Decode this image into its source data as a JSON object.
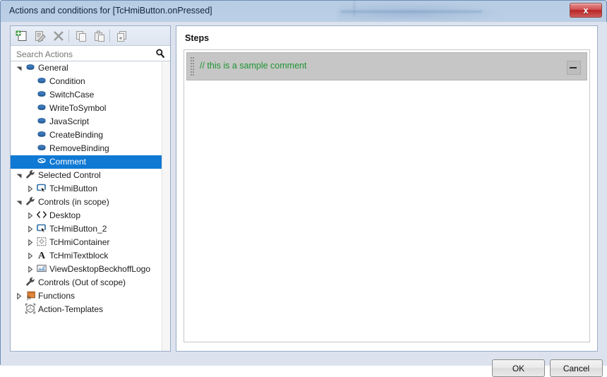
{
  "window": {
    "title": "Actions and conditions for [TcHmiButton.onPressed]",
    "close_label": "x",
    "accent_selected": "#0f79d4",
    "comment_color": "#1f9431",
    "titlebar_color": "#c9dcee",
    "dialog_background": "#dce3ef"
  },
  "toolbar": {
    "items": [
      {
        "name": "new-action-icon",
        "title": "New"
      },
      {
        "name": "edit-action-icon",
        "title": "Edit"
      },
      {
        "name": "delete-action-icon",
        "title": "Delete"
      },
      {
        "name": "copy-action-icon",
        "title": "Copy"
      },
      {
        "name": "paste-action-icon",
        "title": "Paste"
      },
      {
        "name": "duplicate-action-icon",
        "title": "Duplicate"
      }
    ]
  },
  "search": {
    "placeholder": "Search Actions",
    "value": "",
    "icon": "search-icon"
  },
  "tree": {
    "items": [
      {
        "label": "General",
        "depth": 0,
        "icon": "action-node-icon",
        "expander": "expanded",
        "selected": false
      },
      {
        "label": "Condition",
        "depth": 1,
        "icon": "action-node-icon",
        "expander": "none",
        "selected": false
      },
      {
        "label": "SwitchCase",
        "depth": 1,
        "icon": "action-node-icon",
        "expander": "none",
        "selected": false
      },
      {
        "label": "WriteToSymbol",
        "depth": 1,
        "icon": "action-node-icon",
        "expander": "none",
        "selected": false
      },
      {
        "label": "JavaScript",
        "depth": 1,
        "icon": "action-node-icon",
        "expander": "none",
        "selected": false
      },
      {
        "label": "CreateBinding",
        "depth": 1,
        "icon": "action-node-icon",
        "expander": "none",
        "selected": false
      },
      {
        "label": "RemoveBinding",
        "depth": 1,
        "icon": "action-node-icon",
        "expander": "none",
        "selected": false
      },
      {
        "label": "Comment",
        "depth": 1,
        "icon": "comment-node-icon",
        "expander": "none",
        "selected": true
      },
      {
        "label": "Selected Control",
        "depth": 0,
        "icon": "wrench-icon",
        "expander": "expanded",
        "selected": false
      },
      {
        "label": "TcHmiButton",
        "depth": 1,
        "icon": "control-button-icon",
        "expander": "collapsed",
        "selected": false
      },
      {
        "label": "Controls (in scope)",
        "depth": 0,
        "icon": "wrench-icon",
        "expander": "expanded",
        "selected": false
      },
      {
        "label": "Desktop",
        "depth": 1,
        "icon": "code-brackets-icon",
        "expander": "collapsed",
        "selected": false
      },
      {
        "label": "TcHmiButton_2",
        "depth": 1,
        "icon": "control-button-icon",
        "expander": "collapsed",
        "selected": false
      },
      {
        "label": "TcHmiContainer",
        "depth": 1,
        "icon": "container-icon",
        "expander": "collapsed",
        "selected": false
      },
      {
        "label": "TcHmiTextblock",
        "depth": 1,
        "icon": "textblock-icon",
        "expander": "collapsed",
        "selected": false
      },
      {
        "label": "ViewDesktopBeckhoffLogo",
        "depth": 1,
        "icon": "image-icon",
        "expander": "collapsed",
        "selected": false
      },
      {
        "label": "Controls (Out of scope)",
        "depth": 0,
        "icon": "wrench-icon",
        "expander": "none",
        "selected": false
      },
      {
        "label": "Functions",
        "depth": 0,
        "icon": "functions-icon",
        "expander": "collapsed",
        "selected": false
      },
      {
        "label": "Action-Templates",
        "depth": 0,
        "icon": "action-template-icon",
        "expander": "none",
        "selected": false
      }
    ]
  },
  "steps": {
    "title": "Steps",
    "rows": [
      {
        "text": "// this is a sample comment",
        "collapse_label": "–"
      }
    ]
  },
  "footer": {
    "ok_label": "OK",
    "cancel_label": "Cancel"
  }
}
